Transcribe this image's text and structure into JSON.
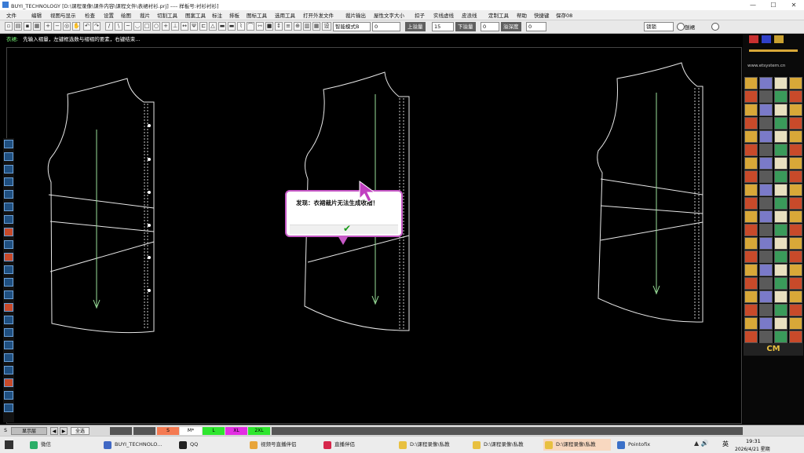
{
  "window": {
    "title": "BUYI_TECHNOLOGY  [D:\\课程录像\\课件内容\\课程文件\\表裙衬衫.prj] ---- 样板号:衬衫衬衫]",
    "minimize": "—",
    "maximize": "☐",
    "close": "✕"
  },
  "menu": [
    "文件",
    "编辑",
    "视图与显示",
    "检查",
    "设置",
    "绘图",
    "裁片",
    "切割工具",
    "图案工具",
    "标注",
    "排板",
    "图标工具",
    "选用工具",
    "打开外发文件",
    "裁片输出",
    "屋性文字大小",
    "扣子",
    "实线虚线",
    "皮浪线",
    "定制工具",
    "帮助",
    "快捷键",
    "保存08"
  ],
  "toolbar": {
    "mode_select": "智能模式B",
    "field1": "0",
    "up_label": "上溢量",
    "up_value": "15",
    "down_label": "下溢量",
    "down_value": "0",
    "depth_label": "溢深度",
    "depth_value": "0",
    "right_select": "锁锁",
    "radio1": "刨裙",
    "radio2": ""
  },
  "prompt": {
    "label": "衣裙:",
    "text": "先输入褶量，左键框选数与褶褶的要素，右键结束..."
  },
  "dialog": {
    "message": "发现：衣裙裁片无法生成收褶！",
    "ok_icon": "✔"
  },
  "brand": {
    "text": "www.etsystem.cn",
    "cm": "CM"
  },
  "statusbar": {
    "s_label": "S",
    "display_layer": "显示层",
    "all_label": "全选",
    "sizes": [
      "S",
      "M*",
      "L",
      "XL",
      "2XL"
    ],
    "size_colors": [
      "#f47a52",
      "#ffffff",
      "#2ee62e",
      "#e22ee2",
      "#2ee62e"
    ]
  },
  "taskbar": {
    "items": [
      {
        "label": "微信",
        "color": "#2aae67"
      },
      {
        "label": "BUYI_TECHNOLO...",
        "color": "#4068c4"
      },
      {
        "label": "QQ",
        "color": "#222222"
      },
      {
        "label": "视频号直播伴侣",
        "color": "#e8a53a"
      },
      {
        "label": "直播伴侣",
        "color": "#d6264a"
      },
      {
        "label": "D:\\课程录像\\私教",
        "color": "#e8c040"
      },
      {
        "label": "D:\\课程录像\\私教",
        "color": "#e8c040"
      },
      {
        "label": "D:\\课程录像\\私教",
        "color": "#e8c040"
      },
      {
        "label": "Pointofix",
        "color": "#3a70c8"
      }
    ],
    "time": "19:31",
    "date": "2026/4/21 星期",
    "ime": "英"
  }
}
